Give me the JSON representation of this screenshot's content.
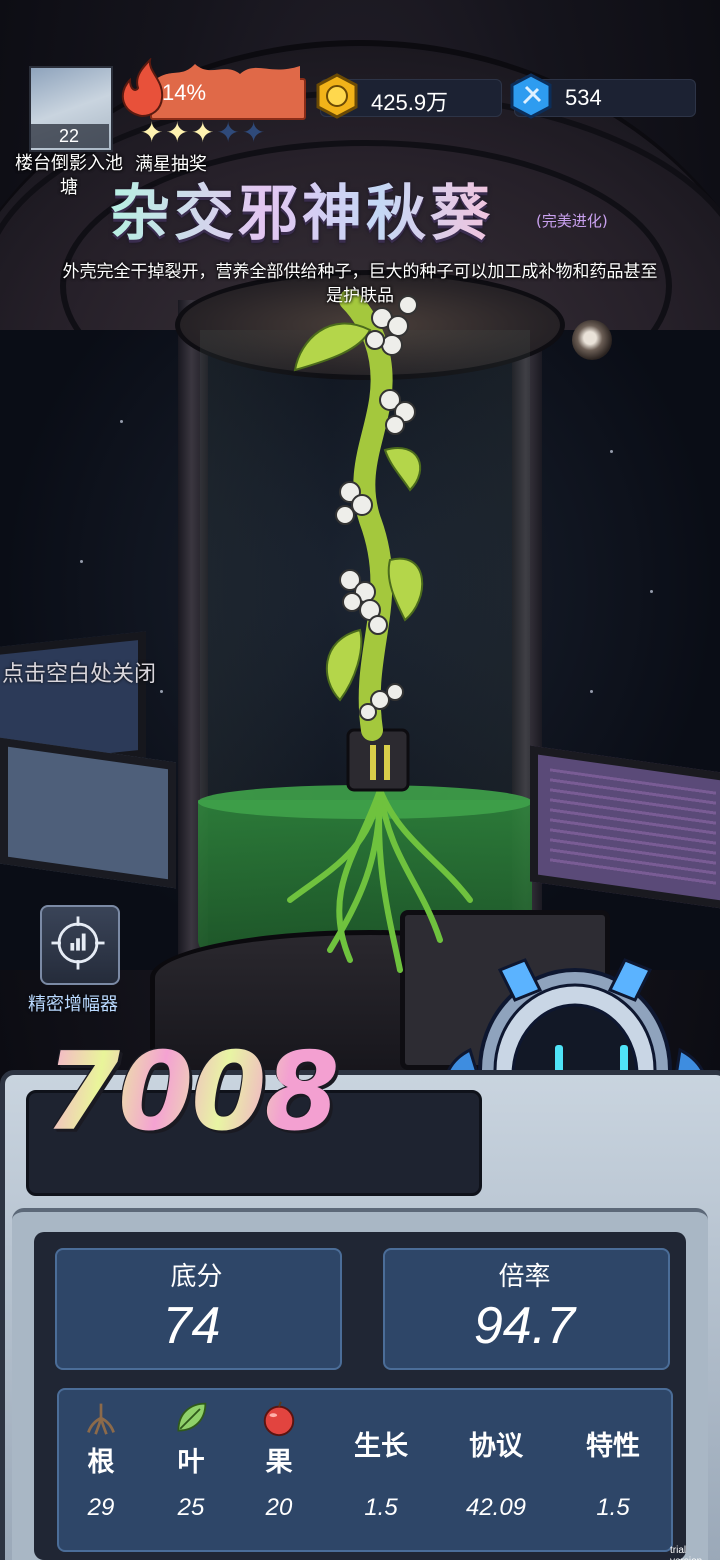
{
  "hud": {
    "location_level": "22",
    "location_name": "楼台倒影入池塘",
    "fire_percent": "14%",
    "fire_progress": 0.14,
    "stars_filled": 3,
    "stars_total": 5,
    "lottery_label": "满星抽奖",
    "coins": "425.9万",
    "gems": "534"
  },
  "plant": {
    "name": "杂交邪神秋葵",
    "evolution_tag": "(完美进化)",
    "description": "外壳完全干掉裂开，营养全部供给种子，巨大的种子可以加工成补物和药品甚至是护肤品"
  },
  "close_hint": "点击空白处关闭",
  "amplifier": {
    "label": "精密增幅器",
    "icon": "target-chart-icon"
  },
  "result": {
    "total_score": "7008",
    "base_label": "底分",
    "base_value": "74",
    "multiplier_label": "倍率",
    "multiplier_value": "94.7",
    "columns": [
      {
        "label": "根",
        "value": "29",
        "icon": "root-icon"
      },
      {
        "label": "叶",
        "value": "25",
        "icon": "leaf-icon"
      },
      {
        "label": "果",
        "value": "20",
        "icon": "fruit-icon"
      },
      {
        "label": "生长",
        "value": "1.5"
      },
      {
        "label": "协议",
        "value": "42.09"
      },
      {
        "label": "特性",
        "value": "1.5"
      }
    ]
  },
  "watermark": "trial version",
  "colors": {
    "fire_bar": "#e06948",
    "panel_card": "#2e4668",
    "amplifier_text": "#b9d9ff",
    "evolution_tag": "#c8a0ee"
  }
}
